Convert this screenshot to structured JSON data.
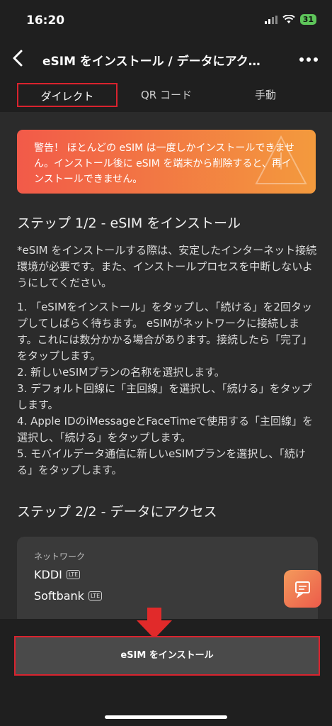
{
  "status": {
    "time": "16:20",
    "battery": "31"
  },
  "header": {
    "title": "eSIM をインストール / データにアク…"
  },
  "tabs": [
    {
      "label": "ダイレクト",
      "active": true
    },
    {
      "label": "QR コード",
      "active": false
    },
    {
      "label": "手動",
      "active": false
    }
  ],
  "warning": {
    "text": "警告！ ほとんどの eSIM は一度しかインストールできません。インストール後に eSIM を端末から削除すると、再インストールできません。"
  },
  "step1": {
    "title": "ステップ 1/2 - eSIM をインストール",
    "note": "*eSIM をインストールする際は、安定したインターネット接続環境が必要です。また、インストールプロセスを中断しないようにしてください。",
    "instructions": "1. 「eSIMをインストール」をタップし、「続ける」を2回タップしてしばらく待ちます。 eSIMがネットワークに接続します。これには数分かかる場合があります。接続したら「完了」をタップします。\n2. 新しいeSIMプランの名称を選択します。\n3. デフォルト回線に「主回線」を選択し、「続ける」をタップします。\n4. Apple IDのiMessageとFaceTimeで使用する「主回線」を選択し、「続ける」をタップします。\n5. モバイルデータ通信に新しいeSIMプランを選択し、「続ける」をタップします。"
  },
  "step2": {
    "title": "ステップ 2/2 - データにアクセス",
    "network_label": "ネットワーク",
    "networks": [
      {
        "name": "KDDI",
        "badge": "LTE"
      },
      {
        "name": "Softbank",
        "badge": "LTE"
      }
    ]
  },
  "install_button": {
    "label": "eSIM をインストール"
  },
  "colors": {
    "accent": "#f25a49",
    "highlight_border": "#d9232e",
    "background": "#2b2b2b"
  }
}
